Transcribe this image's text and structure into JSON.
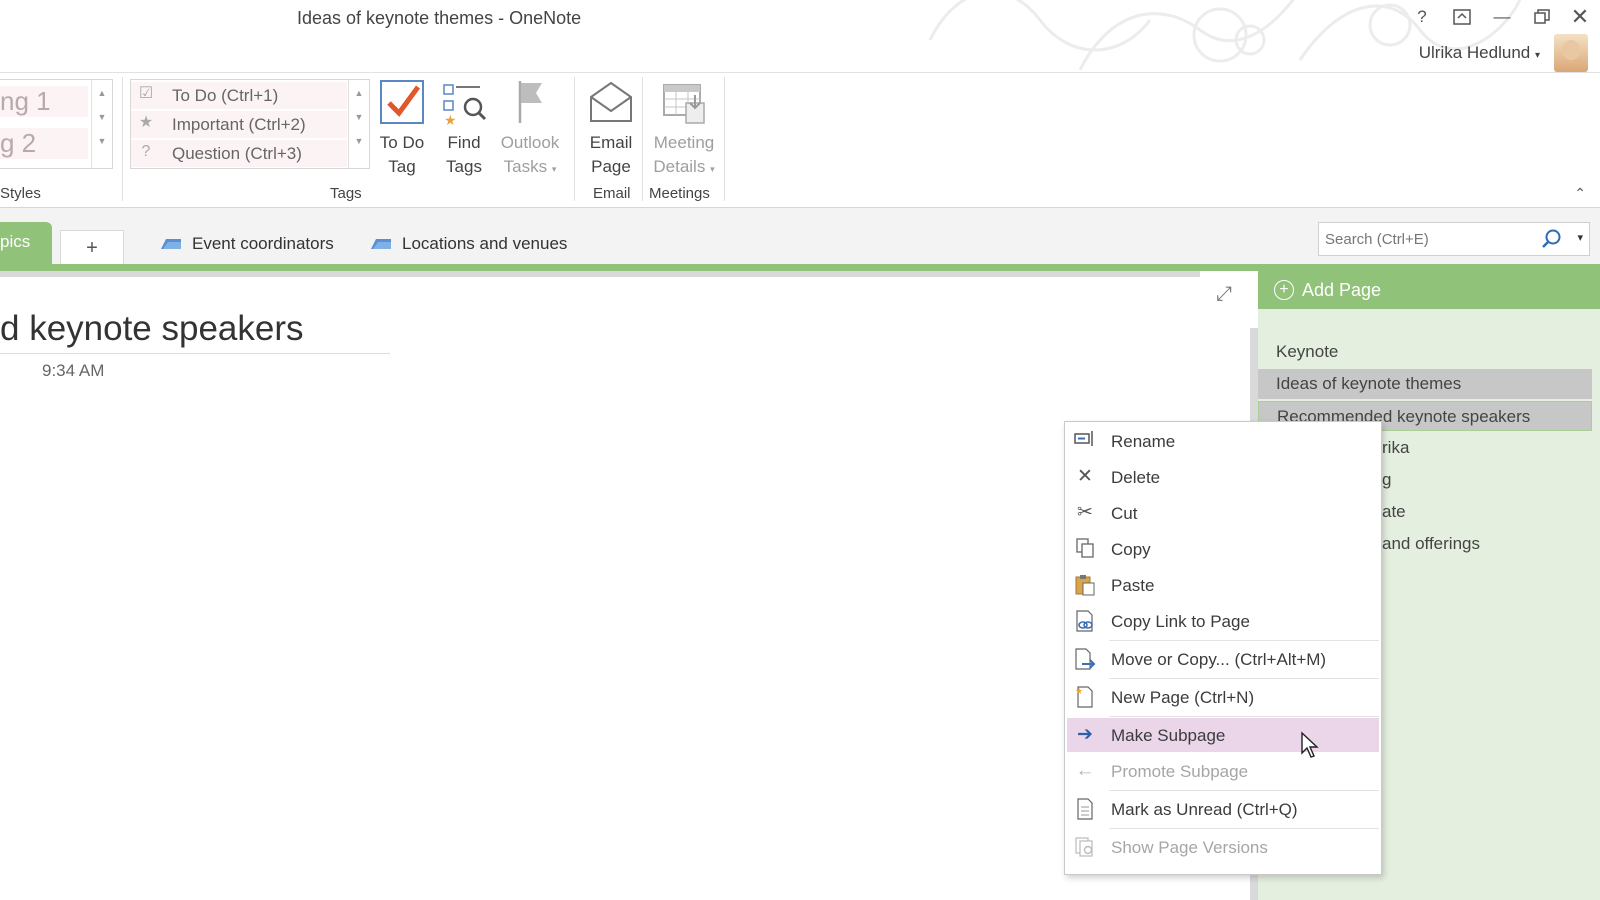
{
  "window": {
    "title": "Ideas of keynote themes - OneNote",
    "user_name": "Ulrika Hedlund",
    "help_label": "?",
    "buttons": [
      "help",
      "ribbon-display-options",
      "minimize",
      "restore",
      "close"
    ]
  },
  "ribbon": {
    "styles": {
      "items": [
        "ng 1",
        "g 2"
      ],
      "group_label": "Styles"
    },
    "tags": {
      "items": [
        {
          "label": "To Do (Ctrl+1)",
          "icon": "checkbox-icon"
        },
        {
          "label": "Important (Ctrl+2)",
          "icon": "star-icon"
        },
        {
          "label": "Question (Ctrl+3)",
          "icon": "question-icon"
        }
      ],
      "group_label": "Tags"
    },
    "buttons": {
      "todo_tag": [
        "To Do",
        "Tag"
      ],
      "find_tags": [
        "Find",
        "Tags"
      ],
      "outlook_tasks": [
        "Outlook",
        "Tasks"
      ],
      "email_page": [
        "Email",
        "Page"
      ],
      "meeting_details": [
        "Meeting",
        "Details"
      ]
    },
    "group_labels": {
      "email": "Email",
      "meetings": "Meetings"
    }
  },
  "tabs": {
    "active": "pics",
    "add_label": "+",
    "sections": [
      "Event coordinators",
      "Locations and venues"
    ]
  },
  "search": {
    "placeholder": "Search (Ctrl+E)"
  },
  "page": {
    "title": "d keynote speakers",
    "time": "9:34 AM"
  },
  "page_pane": {
    "add_label": "Add Page",
    "pages": [
      "Keynote",
      "Ideas of keynote themes",
      "Recommended keynote speakers",
      "rika",
      "g",
      "ate",
      "and offerings"
    ]
  },
  "context_menu": {
    "items": [
      {
        "label": "Rename",
        "icon": "rename-icon",
        "state": "normal"
      },
      {
        "label": "Delete",
        "icon": "delete-icon",
        "state": "normal"
      },
      {
        "label": "Cut",
        "icon": "scissors-icon",
        "state": "normal"
      },
      {
        "label": "Copy",
        "icon": "copy-icon",
        "state": "normal"
      },
      {
        "label": "Paste",
        "icon": "paste-icon",
        "state": "normal"
      },
      {
        "label": "Copy Link to Page",
        "icon": "link-icon",
        "state": "normal"
      },
      {
        "label": "Move or Copy...  (Ctrl+Alt+M)",
        "icon": "move-page-icon",
        "state": "normal"
      },
      {
        "label": "New Page  (Ctrl+N)",
        "icon": "new-page-icon",
        "state": "normal"
      },
      {
        "label": "Make Subpage",
        "icon": "arrow-right-icon",
        "state": "highlighted"
      },
      {
        "label": "Promote Subpage",
        "icon": "arrow-left-icon",
        "state": "disabled"
      },
      {
        "label": "Mark as Unread  (Ctrl+Q)",
        "icon": "mark-unread-icon",
        "state": "normal"
      },
      {
        "label": "Show Page Versions",
        "icon": "page-versions-icon",
        "state": "disabled"
      }
    ]
  },
  "colors": {
    "accent_green": "#90c27a",
    "page_pane_bg": "#e5efdf",
    "menu_highlight": "#ead5e9",
    "todo_check": "#e0582a"
  }
}
